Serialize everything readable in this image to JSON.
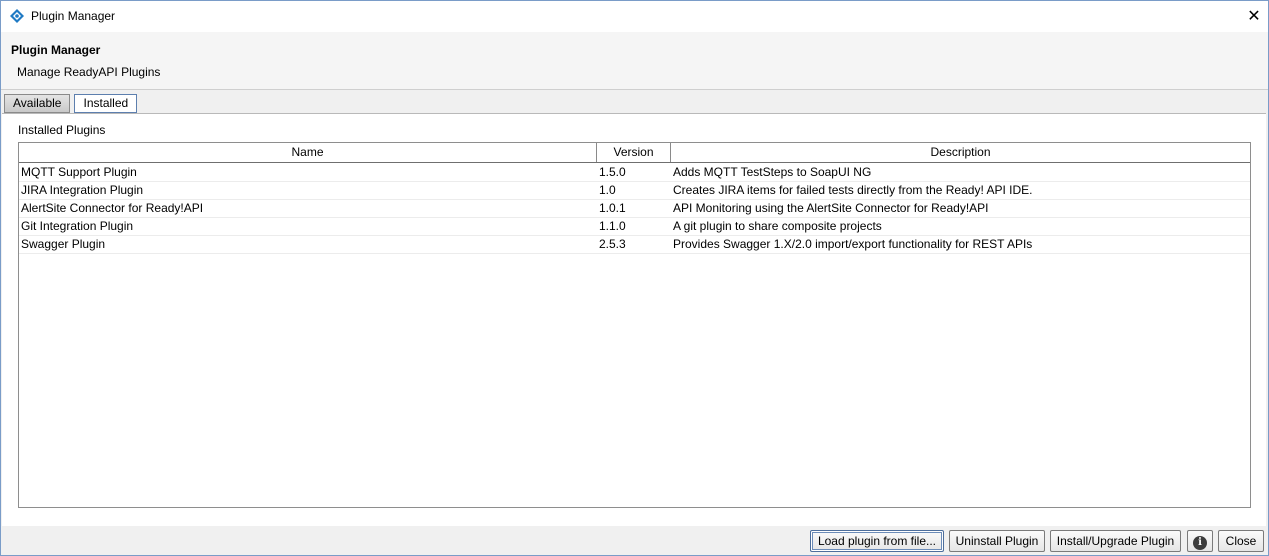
{
  "window": {
    "title": "Plugin Manager",
    "close_glyph": "✕"
  },
  "header": {
    "title": "Plugin Manager",
    "subtitle": "Manage ReadyAPI Plugins"
  },
  "tabs": [
    {
      "label": "Available"
    },
    {
      "label": "Installed",
      "selected": true
    }
  ],
  "section": {
    "label": "Installed Plugins"
  },
  "table": {
    "columns": [
      "Name",
      "Version",
      "Description"
    ],
    "rows": [
      {
        "name": "MQTT Support Plugin",
        "version": "1.5.0",
        "description": "Adds MQTT TestSteps to SoapUI NG"
      },
      {
        "name": "JIRA Integration Plugin",
        "version": "1.0",
        "description": "Creates JIRA items for failed tests directly from the Ready! API IDE."
      },
      {
        "name": "AlertSite Connector for Ready!API",
        "version": "1.0.1",
        "description": "API Monitoring using the AlertSite Connector for Ready!API"
      },
      {
        "name": "Git Integration Plugin",
        "version": "1.1.0",
        "description": "A git plugin to share composite projects"
      },
      {
        "name": "Swagger Plugin",
        "version": "2.5.3",
        "description": "Provides Swagger 1.X/2.0 import/export functionality for REST APIs"
      }
    ]
  },
  "footer": {
    "load_label": "Load plugin from file...",
    "uninstall_label": "Uninstall Plugin",
    "install_label": "Install/Upgrade Plugin",
    "info_glyph": "i",
    "close_label": "Close"
  },
  "icons": {
    "app": "readyapi-logo-icon",
    "info": "info-icon",
    "close": "close-icon"
  },
  "colors": {
    "accent": "#1f7ac4",
    "window_border": "#7a9cc8",
    "focus_border": "#4d6e9c"
  }
}
